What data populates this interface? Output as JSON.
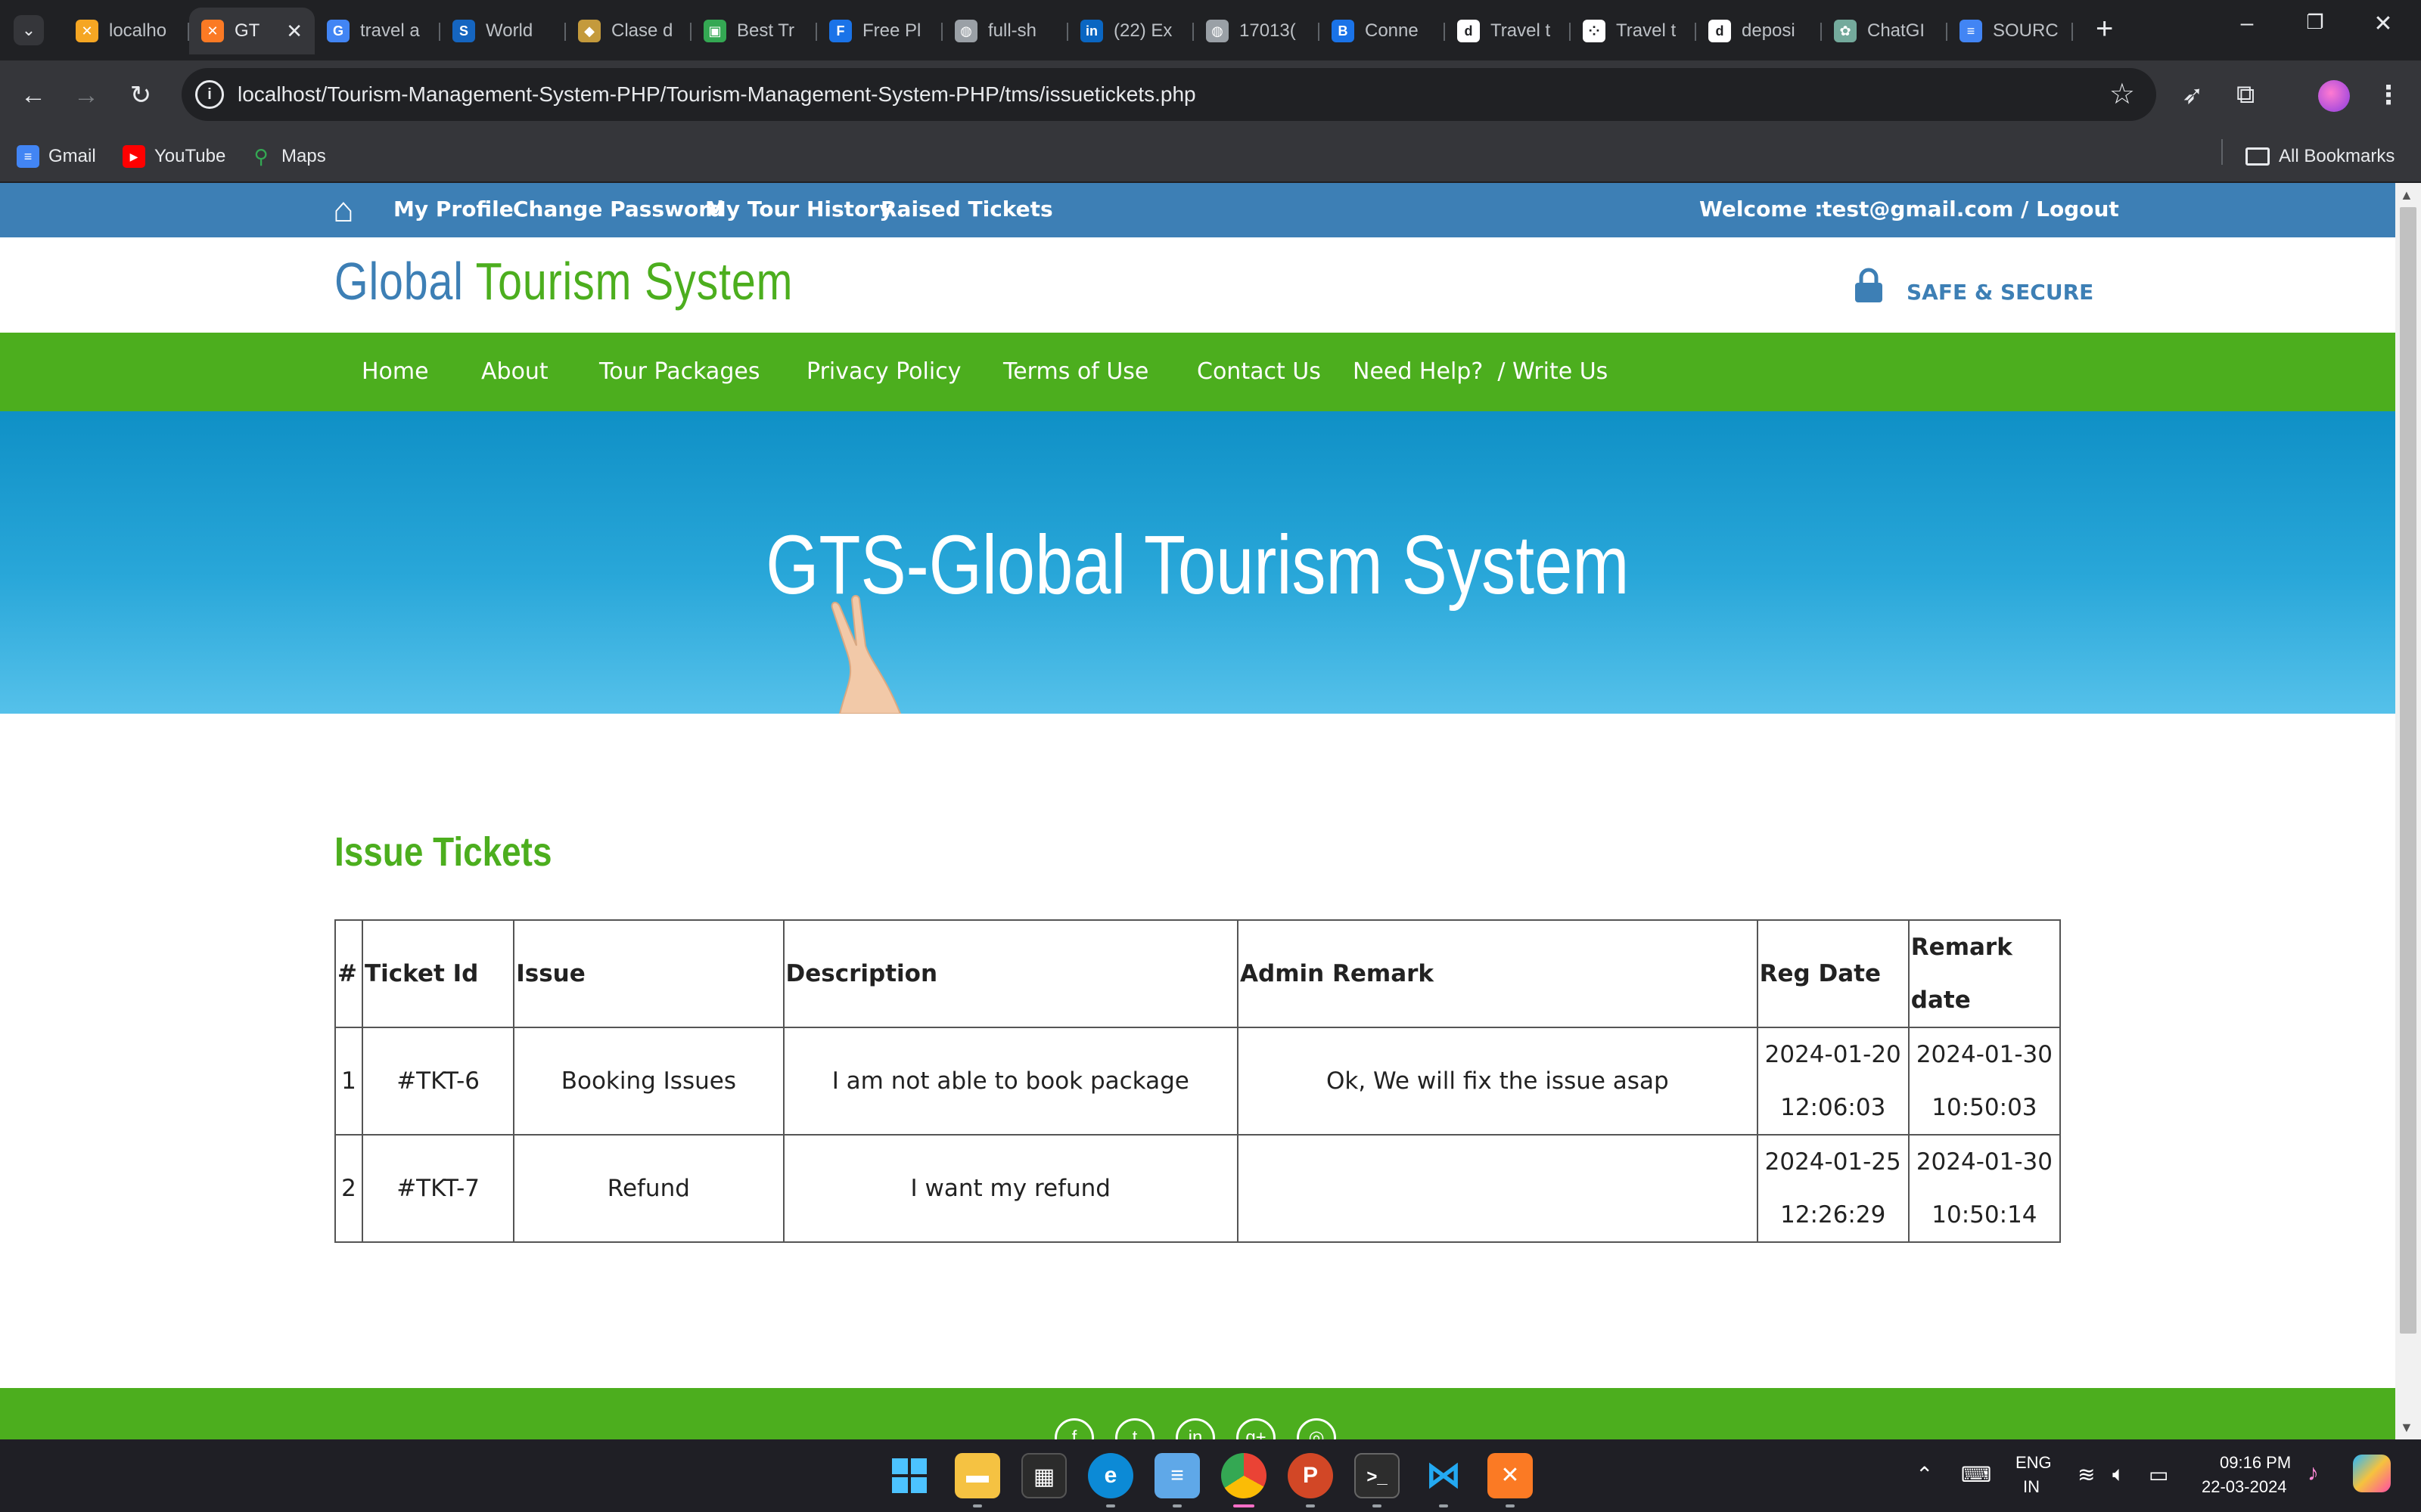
{
  "browser": {
    "tabs": [
      {
        "title": "localho",
        "icon": "xampp-icon",
        "color": "#f5a623"
      },
      {
        "title": "GT",
        "icon": "xampp-icon",
        "color": "#fb7a24",
        "active": true
      },
      {
        "title": "travel a",
        "icon": "google-icon",
        "color": "#4285f4"
      },
      {
        "title": "World",
        "icon": "s-icon",
        "color": "#1565c0"
      },
      {
        "title": "Clase d",
        "icon": "shield-icon",
        "color": "#c49a3c"
      },
      {
        "title": "Best Tr",
        "icon": "tripadvisor-icon",
        "color": "#34a853"
      },
      {
        "title": "Free Pl",
        "icon": "f-icon",
        "color": "#1a73e8"
      },
      {
        "title": "full-sh",
        "icon": "globe-icon",
        "color": "#9aa0a6"
      },
      {
        "title": "(22) Ex",
        "icon": "linkedin-icon",
        "color": "#0a66c2"
      },
      {
        "title": "17013(",
        "icon": "globe-icon",
        "color": "#9aa0a6"
      },
      {
        "title": "Conne",
        "icon": "b-icon",
        "color": "#1a73e8"
      },
      {
        "title": "Travel t",
        "icon": "d-icon",
        "color": "#ffffff"
      },
      {
        "title": "Travel t",
        "icon": "dots-icon",
        "color": "#ffffff"
      },
      {
        "title": "deposi",
        "icon": "d-icon",
        "color": "#ffffff"
      },
      {
        "title": "ChatGI",
        "icon": "chatgpt-icon",
        "color": "#74aa9c"
      },
      {
        "title": "SOURC",
        "icon": "docs-icon",
        "color": "#4285f4"
      }
    ],
    "url": "localhost/Tourism-Management-System-PHP/Tourism-Management-System-PHP/tms/issuetickets.php",
    "bookmarks": [
      {
        "label": "Gmail",
        "icon": "gmail-icon"
      },
      {
        "label": "YouTube",
        "icon": "youtube-icon"
      },
      {
        "label": "Maps",
        "icon": "maps-icon"
      }
    ],
    "all_bookmarks": "All Bookmarks"
  },
  "site": {
    "top_links": [
      "My Profile",
      "Change Password",
      "My Tour History",
      "Raised Tickets"
    ],
    "welcome_label": "Welcome :",
    "user_logout": "test@gmail.com / Logout",
    "logo_part1": "Global ",
    "logo_part2": "Tourism System",
    "secure_label": "SAFE & SECURE",
    "nav": [
      "Home",
      "About",
      "Tour Packages",
      "Privacy Policy",
      "Terms of Use",
      "Contact Us",
      "Need Help?  / Write Us"
    ],
    "banner_title": "GTS-Global Tourism System",
    "section_title": "Issue Tickets",
    "table": {
      "headers": [
        "#",
        "Ticket Id",
        "Issue",
        "Description",
        "Admin Remark",
        "Reg Date",
        "Remark date"
      ],
      "rows": [
        [
          "1",
          "#TKT-6",
          "Booking Issues",
          "I am not able to book package",
          "Ok, We will fix the issue asap",
          "2024-01-20 12:06:03",
          "2024-01-30 10:50:03"
        ],
        [
          "2",
          "#TKT-7",
          "Refund",
          "I want my refund",
          "",
          "2024-01-25 12:26:29",
          "2024-01-30 10:50:14"
        ]
      ]
    }
  },
  "taskbar": {
    "lang_top": "ENG",
    "lang_bottom": "IN",
    "time": "09:16 PM",
    "date": "22-03-2024"
  },
  "colors": {
    "primary_blue": "#3d7fb5",
    "primary_green": "#4cae1e"
  }
}
